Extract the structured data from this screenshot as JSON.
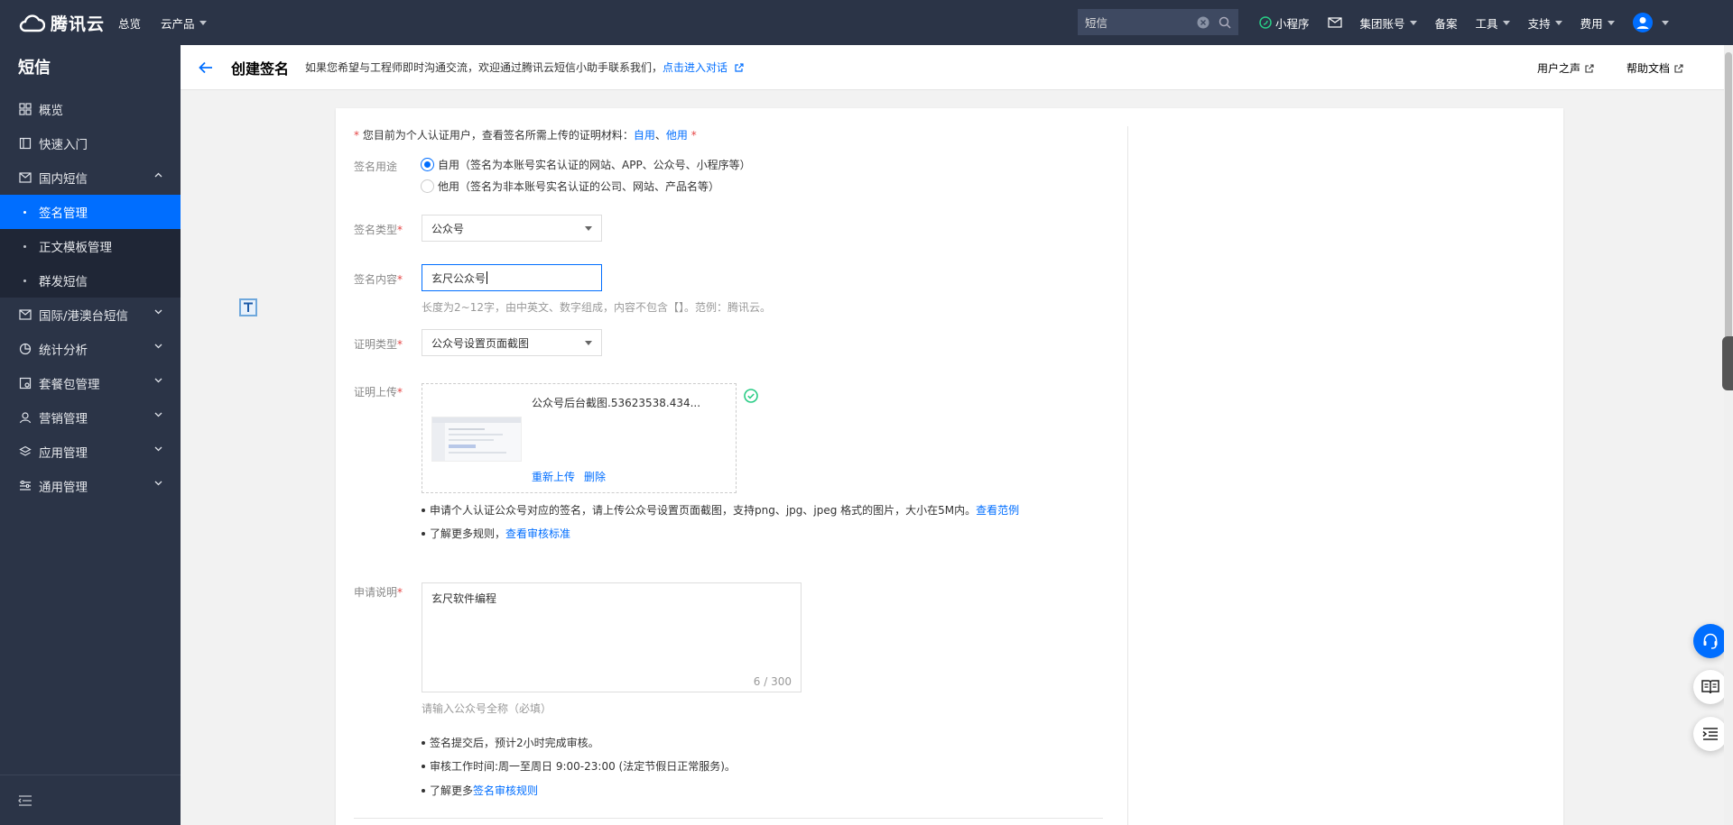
{
  "topbar": {
    "brand": "腾讯云",
    "nav": [
      "总览",
      "云产品"
    ],
    "search_value": "短信",
    "right": [
      "小程序",
      "集团账号",
      "备案",
      "工具",
      "支持",
      "费用"
    ]
  },
  "sidebar": {
    "title": "短信",
    "items_top": [
      {
        "label": "概览",
        "icon": "grid-icon"
      },
      {
        "label": "快速入门",
        "icon": "book-icon"
      },
      {
        "label": "国内短信",
        "icon": "mail-icon"
      }
    ],
    "submenu": [
      {
        "label": "签名管理",
        "active": true
      },
      {
        "label": "正文模板管理",
        "active": false
      },
      {
        "label": "群发短信",
        "active": false
      }
    ],
    "items_bottom": [
      {
        "label": "国际/港澳台短信",
        "icon": "mail-icon"
      },
      {
        "label": "统计分析",
        "icon": "pie-icon"
      },
      {
        "label": "套餐包管理",
        "icon": "package-icon"
      },
      {
        "label": "营销管理",
        "icon": "person-icon"
      },
      {
        "label": "应用管理",
        "icon": "layers-icon"
      },
      {
        "label": "通用管理",
        "icon": "sliders-icon"
      }
    ]
  },
  "header": {
    "title": "创建签名",
    "tip": "如果您希望与工程师即时沟通交流，欢迎通过腾讯云短信小助手联系我们，",
    "tip_link": "点击进入对话",
    "right_links": [
      "用户之声",
      "帮助文档"
    ]
  },
  "form": {
    "notice_prefix": "* ",
    "notice": "您目前为个人认证用户，查看签名所需上传的证明材料：",
    "notice_link1": "自用",
    "notice_sep": "、",
    "notice_link2": "他用",
    "notice_suffix": " *",
    "purpose_label": "签名用途",
    "purpose_options": [
      "自用（签名为本账号实名认证的网站、APP、公众号、小程序等）",
      "他用（签名为非本账号实名认证的公司、网站、产品名等）"
    ],
    "purpose_selected": "自用",
    "type_label": "签名类型",
    "type_value": "公众号",
    "content_label": "签名内容",
    "content_value": "玄尺公众号",
    "content_hint": "长度为2~12字，由中英文、数字组成，内容不包含【】。范例：腾讯云。",
    "proof_type_label": "证明类型",
    "proof_type_value": "公众号设置页面截图",
    "upload_label": "证明上传",
    "upload_file": "公众号后台截图.53623538.434...",
    "upload_reupload": "重新上传",
    "upload_delete": "删除",
    "upload_note1": "申请个人认证公众号对应的签名，请上传公众号设置页面截图，支持png、jpg、jpeg 格式的图片，大小在5M内。",
    "upload_note1_link": "查看范例",
    "upload_note2": "了解更多规则，",
    "upload_note2_link": "查看审核标准",
    "desc_label": "申请说明",
    "desc_value": "玄尺软件编程",
    "desc_counter": "6 / 300",
    "desc_hint": "请输入公众号全称（必填）",
    "notes": [
      "签名提交后，预计2小时完成审核。",
      "审核工作时间:周一至周日 9:00-23:00 (法定节假日正常服务)。"
    ],
    "notes_more": "了解更多",
    "notes_more_link": "签名审核规则",
    "required_mark": "*"
  },
  "colors": {
    "accent": "#006eff",
    "sidebar": "#2b3447",
    "success": "#29cc85"
  }
}
